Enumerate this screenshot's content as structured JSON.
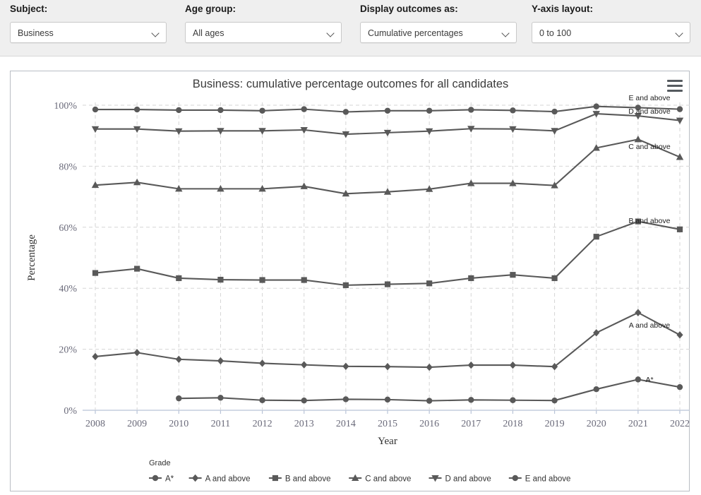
{
  "controls": [
    {
      "label": "Subject:",
      "value": "Business",
      "icon": "chevron-down-icon",
      "name": "subject"
    },
    {
      "label": "Age group:",
      "value": "All ages",
      "icon": "chevron-down-icon",
      "name": "age-group"
    },
    {
      "label": "Display outcomes as:",
      "value": "Cumulative percentages",
      "icon": "chevron-down-icon",
      "name": "display-outcomes-as"
    },
    {
      "label": "Y-axis layout:",
      "value": "0 to 100",
      "icon": "chevron-down-icon",
      "name": "y-axis-layout"
    }
  ],
  "chart_panel": {
    "title": "Business: cumulative percentage outcomes for all candidates",
    "menu_icon": "hamburger-menu-icon"
  },
  "chart_data": {
    "type": "line",
    "title": "Business: cumulative percentage outcomes for all candidates",
    "xlabel": "Year",
    "ylabel": "Percentage",
    "ylim": [
      0,
      100
    ],
    "ytick_labels": [
      "0%",
      "20%",
      "40%",
      "60%",
      "80%",
      "100%"
    ],
    "ytick_values": [
      0,
      20,
      40,
      60,
      80,
      100
    ],
    "grid": true,
    "legend_position": "bottom",
    "legend_title": "Grade",
    "categories": [
      2008,
      2009,
      2010,
      2011,
      2012,
      2013,
      2014,
      2015,
      2016,
      2017,
      2018,
      2019,
      2020,
      2021,
      2022
    ],
    "series": [
      {
        "name": "A*",
        "label": "A*",
        "marker": "circle",
        "color": "#595959",
        "values": [
          null,
          null,
          3.9,
          4.1,
          3.3,
          3.2,
          3.6,
          3.5,
          3.1,
          3.4,
          3.3,
          3.2,
          6.9,
          10.1,
          7.6
        ]
      },
      {
        "name": "A and above",
        "label": "A and above",
        "marker": "diamond",
        "color": "#595959",
        "values": [
          17.6,
          18.9,
          16.7,
          16.2,
          15.4,
          14.9,
          14.4,
          14.3,
          14.1,
          14.8,
          14.8,
          14.3,
          25.4,
          32.0,
          24.7
        ]
      },
      {
        "name": "B and above",
        "label": "B and above",
        "marker": "square",
        "color": "#595959",
        "values": [
          45.0,
          46.4,
          43.3,
          42.8,
          42.7,
          42.7,
          41.0,
          41.3,
          41.6,
          43.3,
          44.4,
          43.3,
          56.9,
          61.9,
          59.3
        ]
      },
      {
        "name": "C and above",
        "label": "C and above",
        "marker": "triangle-up",
        "color": "#595959",
        "values": [
          73.8,
          74.7,
          72.6,
          72.6,
          72.6,
          73.4,
          71.0,
          71.6,
          72.5,
          74.4,
          74.4,
          73.7,
          86.0,
          88.8,
          83.0
        ]
      },
      {
        "name": "D and above",
        "label": "D and above",
        "marker": "triangle-down",
        "color": "#595959",
        "values": [
          92.2,
          92.2,
          91.5,
          91.6,
          91.6,
          91.9,
          90.5,
          91.0,
          91.5,
          92.3,
          92.2,
          91.6,
          97.2,
          96.5,
          95.0
        ]
      },
      {
        "name": "E and above",
        "label": "E and above",
        "marker": "circle",
        "color": "#595959",
        "values": [
          98.6,
          98.6,
          98.4,
          98.4,
          98.2,
          98.7,
          97.8,
          98.2,
          98.2,
          98.5,
          98.3,
          97.9,
          99.6,
          99.2,
          98.7
        ]
      }
    ]
  }
}
